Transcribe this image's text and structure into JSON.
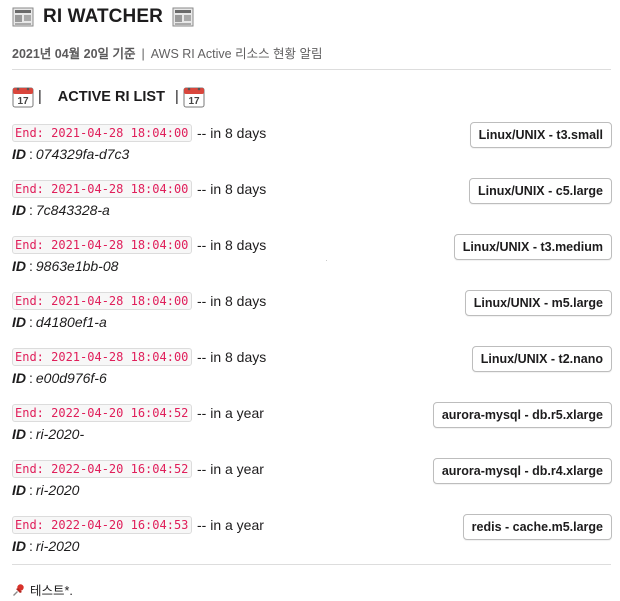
{
  "header": {
    "title": "RI WATCHER",
    "left_icon": "newspaper-icon",
    "right_icon": "newspaper-icon"
  },
  "subtitle": {
    "date": "2021년 04월 20일 기준",
    "separator": "|",
    "text": "AWS RI Active 리소스 현황 알림"
  },
  "list_header": {
    "title": "ACTIVE RI LIST",
    "pipe_left": "|",
    "pipe_right": "|",
    "icon": "calendar-icon"
  },
  "id_label": "ID",
  "id_separator": ":",
  "items": [
    {
      "end": "End: 2021-04-28 18:04:00",
      "remaining": "-- in 8 days",
      "id": "074329fa-d7c3",
      "type": "Linux/UNIX - t3.small"
    },
    {
      "end": "End: 2021-04-28 18:04:00",
      "remaining": "-- in 8 days",
      "id": "7c843328-a",
      "type": "Linux/UNIX - c5.large"
    },
    {
      "end": "End: 2021-04-28 18:04:00",
      "remaining": "-- in 8 days",
      "id": "9863e1bb-08",
      "type": "Linux/UNIX - t3.medium"
    },
    {
      "end": "End: 2021-04-28 18:04:00",
      "remaining": "-- in 8 days",
      "id": "d4180ef1-a",
      "type": "Linux/UNIX - m5.large"
    },
    {
      "end": "End: 2021-04-28 18:04:00",
      "remaining": "-- in 8 days",
      "id": "e00d976f-6",
      "type": "Linux/UNIX - t2.nano"
    },
    {
      "end": "End: 2022-04-20 16:04:52",
      "remaining": "-- in a year",
      "id": "ri-2020-",
      "type": "aurora-mysql - db.r5.xlarge"
    },
    {
      "end": "End: 2022-04-20 16:04:52",
      "remaining": "-- in a year",
      "id": "ri-2020",
      "type": "aurora-mysql - db.r4.xlarge"
    },
    {
      "end": "End: 2022-04-20 16:04:53",
      "remaining": "-- in a year",
      "id": "ri-2020",
      "type": "redis - cache.m5.large"
    }
  ],
  "footer": {
    "icon": "pushpin-icon",
    "text": "테스트*."
  },
  "colors": {
    "code_text": "#e01e5a",
    "code_bg": "#f7f7f7",
    "muted_text": "#616061",
    "divider": "#dddddd"
  }
}
